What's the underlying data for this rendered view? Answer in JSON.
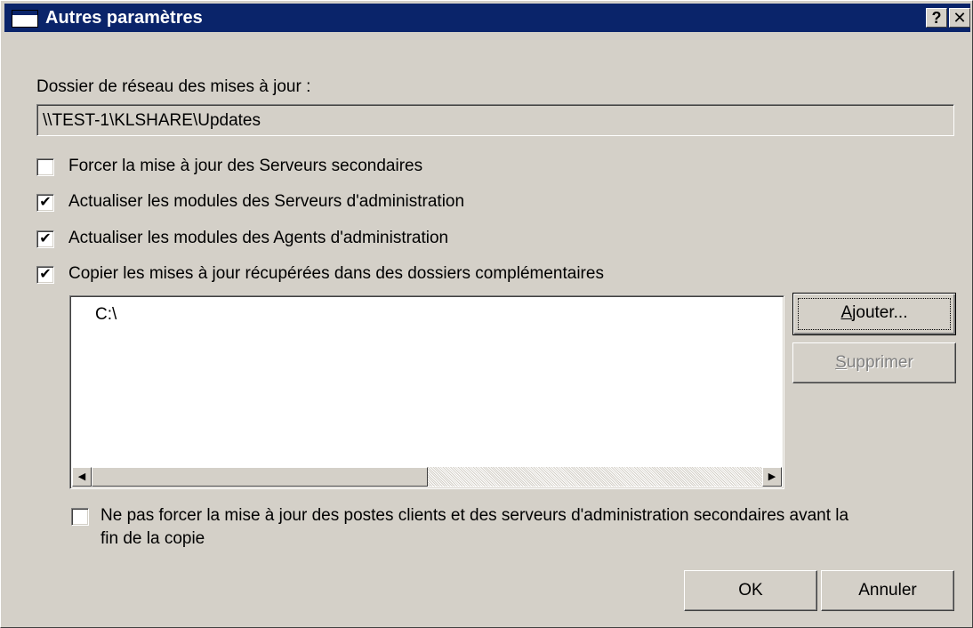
{
  "window": {
    "title": "Autres paramètres",
    "help_glyph": "?",
    "close_glyph": "✕"
  },
  "update_folder": {
    "label": "Dossier de réseau des mises à jour :",
    "value": "\\\\TEST-1\\KLSHARE\\Updates"
  },
  "options": [
    {
      "label": "Forcer la mise à jour des Serveurs secondaires",
      "checked": false
    },
    {
      "label": "Actualiser les modules des Serveurs d'administration",
      "checked": true
    },
    {
      "label": "Actualiser les modules des Agents d'administration",
      "checked": true
    },
    {
      "label": "Copier les mises à jour récupérées dans des dossiers complémentaires",
      "checked": true
    }
  ],
  "folders_list": {
    "items": [
      "C:\\"
    ],
    "scroll_left_glyph": "◀",
    "scroll_right_glyph": "▶"
  },
  "buttons": {
    "add": {
      "first": "A",
      "rest": "jouter..."
    },
    "remove": {
      "first": "S",
      "rest": "upprimer"
    },
    "ok": "OK",
    "cancel": "Annuler"
  },
  "no_force_option": {
    "line1": "Ne pas forcer la mise à jour des postes clients et des serveurs d'administration secondaires avant la",
    "line2": "fin de la copie",
    "checked": false
  },
  "icons": {
    "app": "window-icon",
    "help": "help-icon",
    "close": "close-icon",
    "check": "checkmark-icon"
  }
}
